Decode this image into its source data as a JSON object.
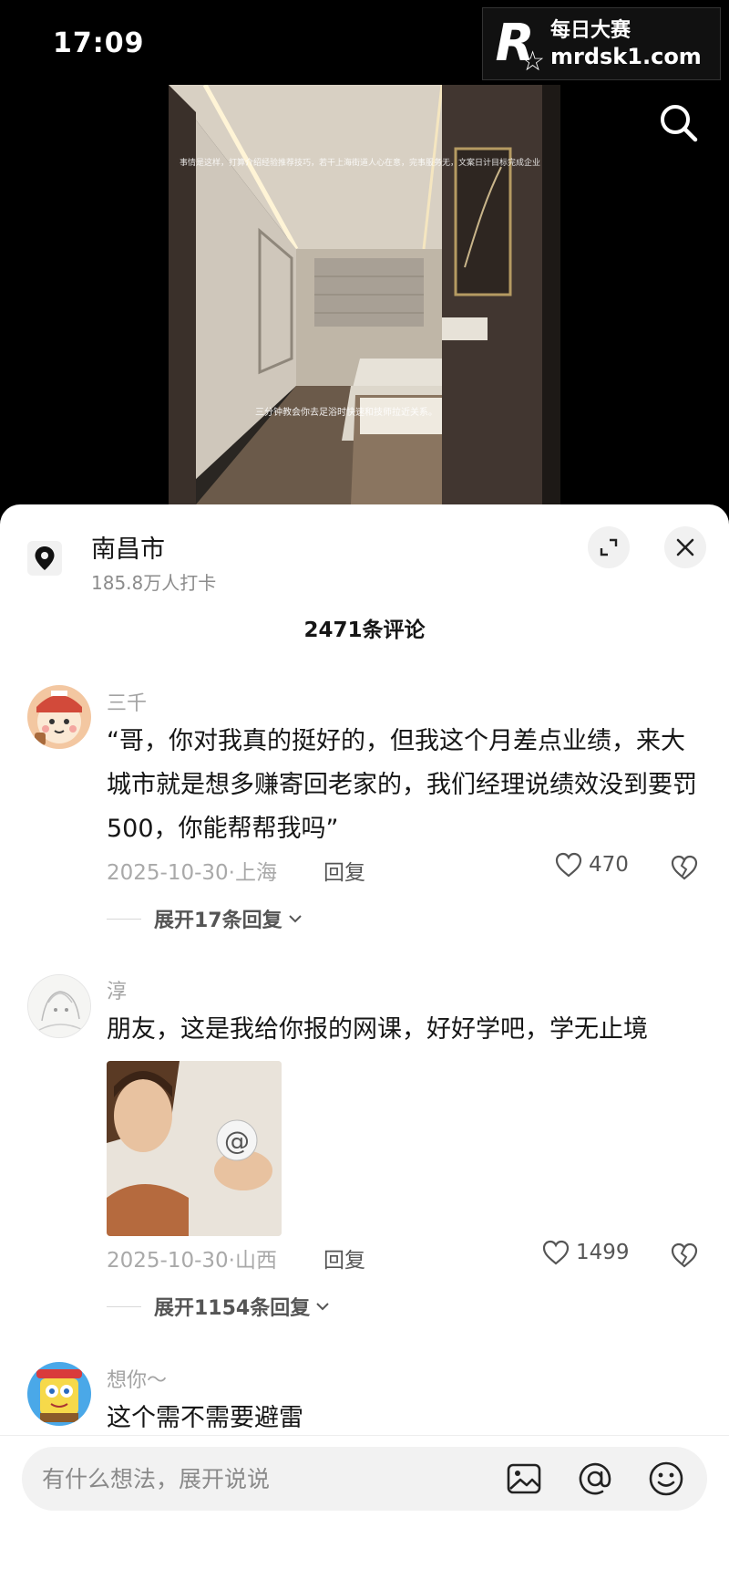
{
  "status_bar": {
    "time": "17:09"
  },
  "watermark": {
    "logo_letter": "R",
    "line1": "每日大赛",
    "line2": "mrdsk1.com"
  },
  "video": {
    "caption_top": "事情是这样，打算介绍经验推荐技巧，若干上海街道人心在意，完事服务无，文案日计目标完成企业",
    "caption_bottom": "三分钟教会你去足浴时快速和技师拉近关系。"
  },
  "sheet": {
    "location": {
      "name": "南昌市",
      "checkins": "185.8万人打卡"
    },
    "comment_count": "2471条评论",
    "comments": [
      {
        "user": "三千",
        "text": "“哥，你对我真的挺好的，但我这个月差点业绩，来大城市就是想多赚寄回老家的，我们经理说绩效没到要罚500，你能帮帮我吗”",
        "meta": "2025-10-30·上海",
        "reply_label": "回复",
        "likes": "470",
        "expand_label": "展开17条回复"
      },
      {
        "user": "淳",
        "text": "朋友，这是我给你报的网课，好好学吧，学无止境",
        "meta": "2025-10-30·山西",
        "reply_label": "回复",
        "likes": "1499",
        "expand_label": "展开1154条回复"
      },
      {
        "user": "想你～",
        "text": "这个需不需要避雷"
      }
    ]
  },
  "input_bar": {
    "placeholder": "有什么想法，展开说说"
  },
  "icons": {
    "search": "search-icon",
    "location": "location-pin-icon",
    "expand": "expand-icon",
    "close": "close-icon",
    "like": "heart-icon",
    "dislike": "broken-heart-icon",
    "image": "image-icon",
    "mention": "at-icon",
    "emoji": "emoji-icon"
  }
}
